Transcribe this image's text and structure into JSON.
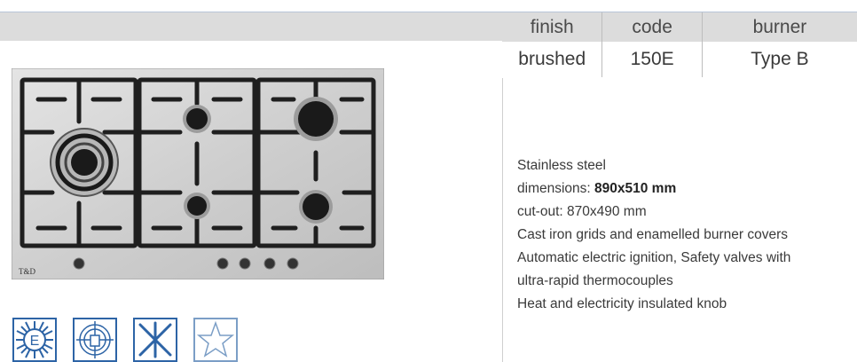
{
  "spec_table": {
    "headers": [
      "finish",
      "code",
      "burner"
    ],
    "values": [
      "brushed",
      "150E",
      "Type B"
    ]
  },
  "product": {
    "brand_label": "T&D"
  },
  "features": {
    "line1": "Stainless steel",
    "line2_prefix": "dimensions: ",
    "line2_value": "890x510 mm",
    "line3": "cut-out: 870x490 mm",
    "line4": "Cast iron grids and enamelled burner covers",
    "line5": "Automatic electric ignition, Safety valves with",
    "line6": "ultra-rapid thermocouples",
    "line7": "Heat and electricity insulated knob"
  },
  "badges": {
    "energy_letter": "E",
    "icons": [
      "energy-class-icon",
      "safety-valve-icon",
      "ignition-icon",
      "quality-star-icon"
    ]
  },
  "colors": {
    "header_band": "#dcdcdc",
    "badge_blue": "#2d64a6",
    "steel": "#c9c9c9",
    "cast_iron": "#1f1f1f"
  }
}
